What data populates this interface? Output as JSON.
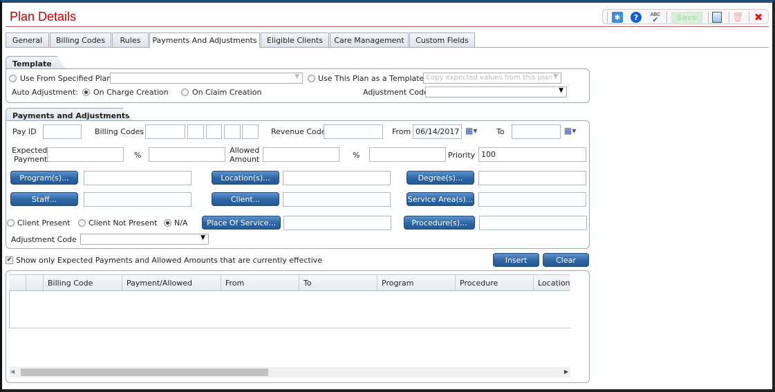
{
  "header": {
    "title": "Plan Details"
  },
  "toolbar": {
    "settings_icon": "gear-icon",
    "help_icon": "help-icon",
    "spellcheck_label": "ABC",
    "save_label": "Save",
    "new_icon": "document-icon",
    "delete_icon": "trash-icon",
    "close_icon": "close-x-icon"
  },
  "tabs": [
    {
      "label": "General"
    },
    {
      "label": "Billing Codes"
    },
    {
      "label": "Rules"
    },
    {
      "label": "Payments And Adjustments",
      "active": true
    },
    {
      "label": "Eligible Clients"
    },
    {
      "label": "Care Management"
    },
    {
      "label": "Custom Fields"
    }
  ],
  "template": {
    "title": "Template",
    "use_from_plan": "Use From Specified Plan",
    "use_this_plan": "Use This Plan as a Template",
    "copy_select": "Copy expected values from this plan",
    "auto_adjustment": "Auto Adjustment:",
    "on_charge": "On Charge Creation",
    "on_claim": "On Claim Creation",
    "selected_auto": "On Charge Creation",
    "adjustment_code": "Adjustment Code"
  },
  "payments": {
    "title": "Payments and Adjustments",
    "pay_id": "Pay ID",
    "billing_codes": "Billing Codes",
    "revenue_code": "Revenue Code",
    "from": "From",
    "from_value": "06/14/2017",
    "to": "To",
    "to_value": "",
    "expected_line1": "Expected",
    "expected_line2": "Payment",
    "percent1": "%",
    "allowed_line1": "Allowed",
    "allowed_line2": "Amount",
    "percent2": "%",
    "priority": "Priority",
    "priority_value": "100",
    "programs": "Program(s)...",
    "locations": "Location(s)...",
    "degrees": "Degree(s)...",
    "staff": "Staff...",
    "client": "Client...",
    "service_areas": "Service Area(s)...",
    "client_present": "Client Present",
    "client_not_present": "Client Not Present",
    "na": "N/A",
    "selected_presence": "N/A",
    "place_of_service": "Place Of Service...",
    "procedures": "Procedure(s)...",
    "adjustment_code": "Adjustment Code"
  },
  "filter": {
    "show_effective": "Show only Expected Payments and Allowed Amounts that are currently effective",
    "checked": true
  },
  "actions": {
    "insert": "Insert",
    "clear": "Clear"
  },
  "grid": {
    "columns": [
      "",
      "",
      "Billing Code",
      "Payment/Allowed",
      "From",
      "To",
      "Program",
      "Procedure",
      "Location"
    ],
    "rows": []
  }
}
